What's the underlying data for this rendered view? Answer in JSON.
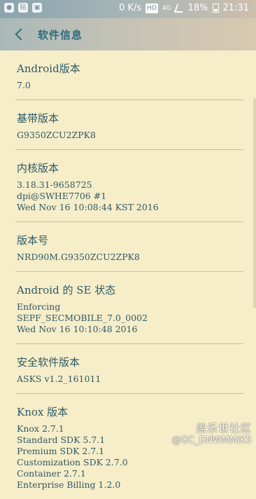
{
  "status_bar": {
    "left_icons": [
      "wechat-icon",
      "tieba-icon",
      "image-icon"
    ],
    "speed": "0 K/s",
    "hd": "HD",
    "network": "4G",
    "battery": "18%",
    "time": "21:31"
  },
  "header": {
    "title": "软件信息"
  },
  "items": [
    {
      "label": "Android版本",
      "lines": [
        "7.0"
      ]
    },
    {
      "label": "基带版本",
      "lines": [
        "G9350ZCU2ZPK8"
      ]
    },
    {
      "label": "内核版本",
      "lines": [
        "3.18.31-9658725",
        "dpi@SWHE7706 #1",
        "Wed Nov 16 10:08:44 KST 2016"
      ]
    },
    {
      "label": "版本号",
      "lines": [
        "NRD90M.G9350ZCU2ZPK8"
      ]
    },
    {
      "label": "Android 的 SE 状态",
      "lines": [
        "Enforcing",
        "SEPF_SECMOBILE_7.0_0002",
        "Wed Nov 16 10:10:48 2016"
      ]
    },
    {
      "label": "安全软件版本",
      "lines": [
        "ASKS v1.2_161011"
      ]
    },
    {
      "label": "Knox 版本",
      "lines": [
        "Knox 2.7.1",
        "Standard SDK 5.7.1",
        "Premium SDK 2.7.1",
        "Customization SDK 2.7.0",
        "Container 2.7.1",
        "Enterprise Billing 1.2.0"
      ]
    }
  ],
  "watermark": {
    "line1": "盖乐世社区",
    "line2": "@GC_DNWMMIK5"
  }
}
